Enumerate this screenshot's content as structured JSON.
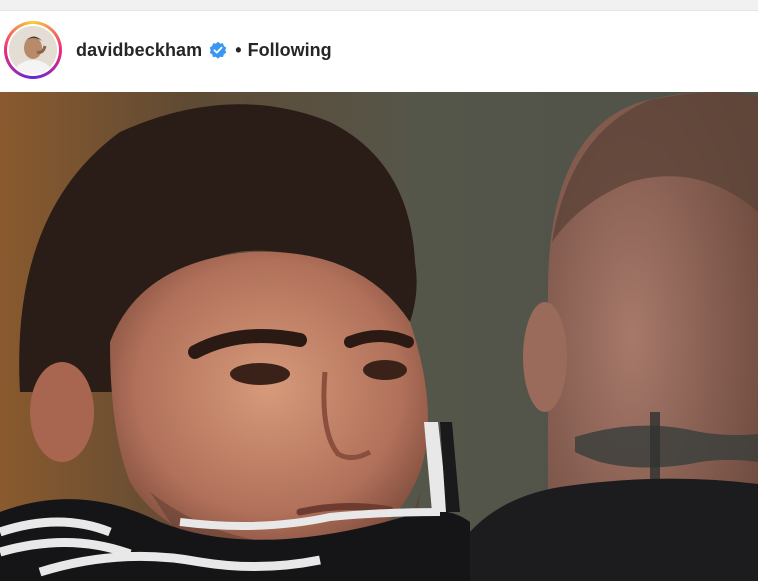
{
  "header": {
    "username": "davidbeckham",
    "separator": "•",
    "follow_state": "Following",
    "verified_icon": "verified-badge-icon"
  },
  "colors": {
    "verified_blue": "#3897f0",
    "text_primary": "#262626",
    "ring_gradient": [
      "#f9ce34",
      "#ee2a7b",
      "#6228d7"
    ]
  }
}
